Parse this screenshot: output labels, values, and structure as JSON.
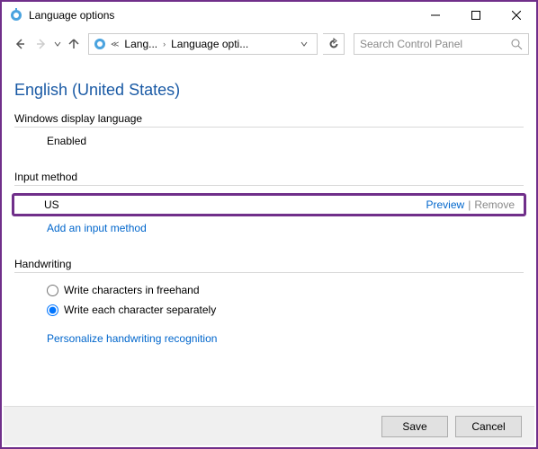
{
  "window": {
    "title": "Language options"
  },
  "breadcrumb": {
    "seg1": "Lang...",
    "seg2": "Language opti..."
  },
  "search": {
    "placeholder": "Search Control Panel"
  },
  "page": {
    "title": "English (United States)"
  },
  "displayLang": {
    "section": "Windows display language",
    "value": "Enabled"
  },
  "inputMethod": {
    "section": "Input method",
    "item": "US",
    "preview": "Preview",
    "remove": "Remove",
    "add": "Add an input method"
  },
  "handwriting": {
    "section": "Handwriting",
    "opt1": "Write characters in freehand",
    "opt2": "Write each character separately",
    "personalize": "Personalize handwriting recognition"
  },
  "footer": {
    "save": "Save",
    "cancel": "Cancel"
  }
}
